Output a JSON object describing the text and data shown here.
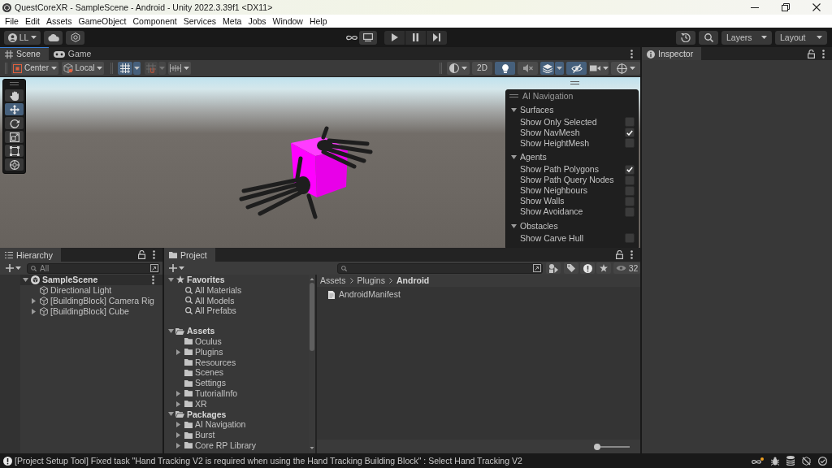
{
  "window": {
    "title": "QuestCoreXR - SampleScene - Android - Unity 2022.3.39f1 <DX11>"
  },
  "menu": [
    "File",
    "Edit",
    "Assets",
    "GameObject",
    "Component",
    "Services",
    "Meta",
    "Jobs",
    "Window",
    "Help"
  ],
  "toolbar": {
    "account": "LL",
    "layers": "Layers",
    "layout": "Layout"
  },
  "scene_panel": {
    "tabs": [
      {
        "label": "Scene",
        "kind": "scene",
        "selected": true
      },
      {
        "label": "Game",
        "kind": "game",
        "selected": false
      }
    ],
    "pivot": "Center",
    "space": "Local",
    "grid_snapping_on": true,
    "increment_snapping_on": false,
    "mode_2d": {
      "label": "2D",
      "on": false
    },
    "lighting_on": true,
    "audio_on": false,
    "effects_on": true,
    "hidden_objects_on": true,
    "tools": [
      {
        "kind": "hand",
        "selected": false
      },
      {
        "kind": "move",
        "selected": true
      },
      {
        "kind": "rotate",
        "selected": false
      },
      {
        "kind": "scale",
        "selected": false
      },
      {
        "kind": "rect",
        "selected": false
      },
      {
        "kind": "transform",
        "selected": false
      }
    ],
    "ai_navigation": {
      "title": "AI Navigation",
      "sections": [
        {
          "title": "Surfaces",
          "expanded": true,
          "options": [
            {
              "label": "Show Only Selected",
              "checked": false
            },
            {
              "label": "Show NavMesh",
              "checked": true
            },
            {
              "label": "Show HeightMesh",
              "checked": false
            }
          ]
        },
        {
          "title": "Agents",
          "expanded": true,
          "options": [
            {
              "label": "Show Path Polygons",
              "checked": true
            },
            {
              "label": "Show Path Query Nodes",
              "checked": false
            },
            {
              "label": "Show Neighbours",
              "checked": false
            },
            {
              "label": "Show Walls",
              "checked": false
            },
            {
              "label": "Show Avoidance",
              "checked": false
            }
          ]
        },
        {
          "title": "Obstacles",
          "expanded": true,
          "options": [
            {
              "label": "Show Carve Hull",
              "checked": false
            }
          ]
        }
      ]
    }
  },
  "inspector": {
    "tab": "Inspector"
  },
  "hierarchy": {
    "tab": "Hierarchy",
    "search": {
      "placeholder": "All"
    },
    "scene": {
      "name": "SampleScene",
      "expanded": true,
      "children": [
        {
          "name": "Directional Light"
        },
        {
          "name": "[BuildingBlock] Camera Rig",
          "expanded": false
        },
        {
          "name": "[BuildingBlock] Cube",
          "expanded": false
        }
      ]
    }
  },
  "project": {
    "tab": "Project",
    "hidden_count": "32",
    "tree": [
      {
        "name": "Favorites",
        "kind": "favorites",
        "expanded": true,
        "children": [
          {
            "name": "All Materials",
            "kind": "search"
          },
          {
            "name": "All Models",
            "kind": "search"
          },
          {
            "name": "All Prefabs",
            "kind": "search"
          }
        ]
      },
      {
        "name": "Assets",
        "kind": "folder",
        "expanded": true,
        "children": [
          {
            "name": "Oculus",
            "kind": "folder"
          },
          {
            "name": "Plugins",
            "kind": "folder",
            "expanded": false
          },
          {
            "name": "Resources",
            "kind": "folder"
          },
          {
            "name": "Scenes",
            "kind": "folder"
          },
          {
            "name": "Settings",
            "kind": "folder"
          },
          {
            "name": "TutorialInfo",
            "kind": "folder",
            "expanded": false
          },
          {
            "name": "XR",
            "kind": "folder",
            "expanded": false
          }
        ]
      },
      {
        "name": "Packages",
        "kind": "folder",
        "expanded": true,
        "children": [
          {
            "name": "AI Navigation",
            "kind": "folder",
            "expanded": false
          },
          {
            "name": "Burst",
            "kind": "folder",
            "expanded": false
          },
          {
            "name": "Core RP Library",
            "kind": "folder",
            "expanded": false
          }
        ]
      }
    ],
    "breadcrumb": [
      "Assets",
      "Plugins",
      "Android"
    ],
    "files": [
      {
        "name": "AndroidManifest"
      }
    ],
    "zoom": {
      "level": 0
    }
  },
  "status_bar": {
    "message": "[Project Setup Tool] Fixed task \"Hand Tracking V2 is required when using the Hand Tracking Building Block\" : Select Hand Tracking V2"
  }
}
